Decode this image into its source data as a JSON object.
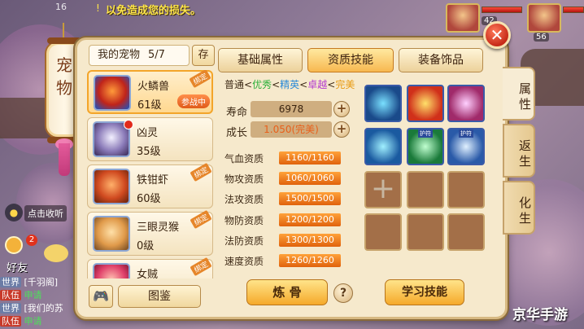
{
  "top_bar": {
    "server_num": "16",
    "notice_icon": "!",
    "notice_text": "以免造成您的损失。",
    "left_level": "42",
    "right_level": "56"
  },
  "lantern": {
    "title": "宠物"
  },
  "chat": {
    "mic_icon": "mic-icon",
    "click_hint": "点击收听",
    "friend_badge": "2",
    "friend_label": "好友",
    "lines": [
      {
        "tag": "世界",
        "text": "[千羽阁]"
      },
      {
        "tag": "队伍",
        "text": "申请"
      },
      {
        "tag": "世界",
        "text": "[我们的苏"
      },
      {
        "tag": "队伍",
        "text": "申请"
      }
    ]
  },
  "pet_panel": {
    "header_label": "我的宠物",
    "header_count": "5/7",
    "store_label": "存",
    "pets": [
      {
        "name": "火鳞兽",
        "level": "61级",
        "tag": "绑定",
        "battle": "参战中"
      },
      {
        "name": "凶灵",
        "level": "35级",
        "tag": "",
        "battle": ""
      },
      {
        "name": "铁钳虾",
        "level": "60级",
        "tag": "绑定",
        "battle": ""
      },
      {
        "name": "三眼灵猴",
        "level": "0级",
        "tag": "绑定",
        "battle": ""
      },
      {
        "name": "女贼",
        "level": "",
        "tag": "绑定",
        "battle": ""
      }
    ],
    "controller_icon": "gamepad-icon",
    "atlas_label": "图鉴"
  },
  "tabs": [
    {
      "label": "基础属性"
    },
    {
      "label": "资质技能"
    },
    {
      "label": "装备饰品"
    }
  ],
  "grades": {
    "g0": "普通",
    "g1": "优秀",
    "g2": "精英",
    "g3": "卓越",
    "g4": "完美",
    "sep": "<"
  },
  "stats": {
    "life_label": "寿命",
    "life_value": "6978",
    "growth_label": "成长",
    "growth_value": "1.050(完美)"
  },
  "aptitudes": [
    {
      "label": "气血资质",
      "value": "1160/1160"
    },
    {
      "label": "物攻资质",
      "value": "1060/1060"
    },
    {
      "label": "法攻资质",
      "value": "1500/1500"
    },
    {
      "label": "物防资质",
      "value": "1200/1200"
    },
    {
      "label": "法防资质",
      "value": "1300/1300"
    },
    {
      "label": "速度资质",
      "value": "1260/1260"
    }
  ],
  "skills": {
    "hu_ti_a": "护符",
    "hu_ti_b": "护符",
    "add_icon": "+"
  },
  "actions": {
    "refine_label": "炼 骨",
    "help_label": "?",
    "learn_label": "学习技能",
    "close_label": "✕"
  },
  "side_tabs": [
    {
      "label": "属性"
    },
    {
      "label": "返生"
    },
    {
      "label": "化生"
    }
  ],
  "watermark": "京华手游",
  "colors": {
    "grade_normal": "#3e2a16",
    "grade_excellent": "#2bb03a",
    "grade_elite": "#2a8ad8",
    "grade_superb": "#b33ad0",
    "grade_perfect": "#e89a10"
  }
}
